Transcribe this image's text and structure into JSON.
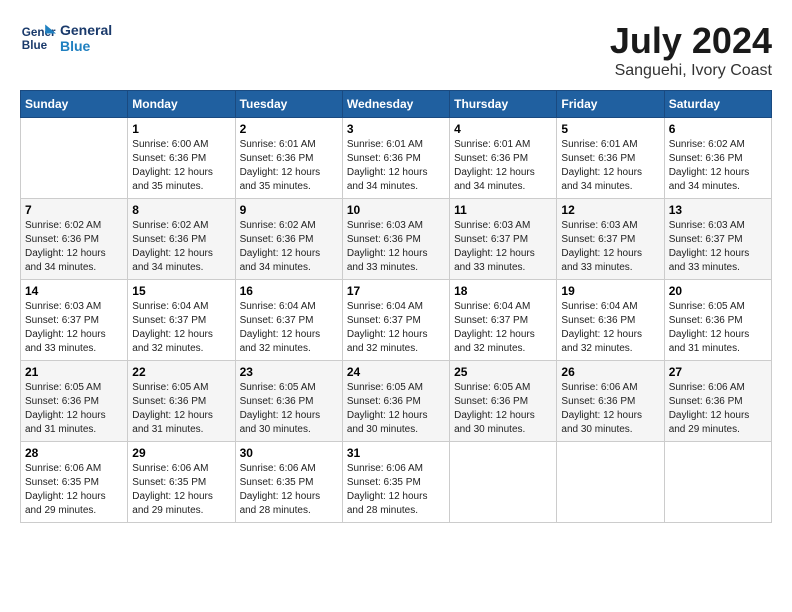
{
  "logo": {
    "line1": "General",
    "line2": "Blue"
  },
  "title": "July 2024",
  "subtitle": "Sanguehi, Ivory Coast",
  "days_of_week": [
    "Sunday",
    "Monday",
    "Tuesday",
    "Wednesday",
    "Thursday",
    "Friday",
    "Saturday"
  ],
  "weeks": [
    [
      {
        "day": "",
        "info": ""
      },
      {
        "day": "1",
        "info": "Sunrise: 6:00 AM\nSunset: 6:36 PM\nDaylight: 12 hours\nand 35 minutes."
      },
      {
        "day": "2",
        "info": "Sunrise: 6:01 AM\nSunset: 6:36 PM\nDaylight: 12 hours\nand 35 minutes."
      },
      {
        "day": "3",
        "info": "Sunrise: 6:01 AM\nSunset: 6:36 PM\nDaylight: 12 hours\nand 34 minutes."
      },
      {
        "day": "4",
        "info": "Sunrise: 6:01 AM\nSunset: 6:36 PM\nDaylight: 12 hours\nand 34 minutes."
      },
      {
        "day": "5",
        "info": "Sunrise: 6:01 AM\nSunset: 6:36 PM\nDaylight: 12 hours\nand 34 minutes."
      },
      {
        "day": "6",
        "info": "Sunrise: 6:02 AM\nSunset: 6:36 PM\nDaylight: 12 hours\nand 34 minutes."
      }
    ],
    [
      {
        "day": "7",
        "info": "Sunrise: 6:02 AM\nSunset: 6:36 PM\nDaylight: 12 hours\nand 34 minutes."
      },
      {
        "day": "8",
        "info": "Sunrise: 6:02 AM\nSunset: 6:36 PM\nDaylight: 12 hours\nand 34 minutes."
      },
      {
        "day": "9",
        "info": "Sunrise: 6:02 AM\nSunset: 6:36 PM\nDaylight: 12 hours\nand 34 minutes."
      },
      {
        "day": "10",
        "info": "Sunrise: 6:03 AM\nSunset: 6:36 PM\nDaylight: 12 hours\nand 33 minutes."
      },
      {
        "day": "11",
        "info": "Sunrise: 6:03 AM\nSunset: 6:37 PM\nDaylight: 12 hours\nand 33 minutes."
      },
      {
        "day": "12",
        "info": "Sunrise: 6:03 AM\nSunset: 6:37 PM\nDaylight: 12 hours\nand 33 minutes."
      },
      {
        "day": "13",
        "info": "Sunrise: 6:03 AM\nSunset: 6:37 PM\nDaylight: 12 hours\nand 33 minutes."
      }
    ],
    [
      {
        "day": "14",
        "info": "Sunrise: 6:03 AM\nSunset: 6:37 PM\nDaylight: 12 hours\nand 33 minutes."
      },
      {
        "day": "15",
        "info": "Sunrise: 6:04 AM\nSunset: 6:37 PM\nDaylight: 12 hours\nand 32 minutes."
      },
      {
        "day": "16",
        "info": "Sunrise: 6:04 AM\nSunset: 6:37 PM\nDaylight: 12 hours\nand 32 minutes."
      },
      {
        "day": "17",
        "info": "Sunrise: 6:04 AM\nSunset: 6:37 PM\nDaylight: 12 hours\nand 32 minutes."
      },
      {
        "day": "18",
        "info": "Sunrise: 6:04 AM\nSunset: 6:37 PM\nDaylight: 12 hours\nand 32 minutes."
      },
      {
        "day": "19",
        "info": "Sunrise: 6:04 AM\nSunset: 6:36 PM\nDaylight: 12 hours\nand 32 minutes."
      },
      {
        "day": "20",
        "info": "Sunrise: 6:05 AM\nSunset: 6:36 PM\nDaylight: 12 hours\nand 31 minutes."
      }
    ],
    [
      {
        "day": "21",
        "info": "Sunrise: 6:05 AM\nSunset: 6:36 PM\nDaylight: 12 hours\nand 31 minutes."
      },
      {
        "day": "22",
        "info": "Sunrise: 6:05 AM\nSunset: 6:36 PM\nDaylight: 12 hours\nand 31 minutes."
      },
      {
        "day": "23",
        "info": "Sunrise: 6:05 AM\nSunset: 6:36 PM\nDaylight: 12 hours\nand 30 minutes."
      },
      {
        "day": "24",
        "info": "Sunrise: 6:05 AM\nSunset: 6:36 PM\nDaylight: 12 hours\nand 30 minutes."
      },
      {
        "day": "25",
        "info": "Sunrise: 6:05 AM\nSunset: 6:36 PM\nDaylight: 12 hours\nand 30 minutes."
      },
      {
        "day": "26",
        "info": "Sunrise: 6:06 AM\nSunset: 6:36 PM\nDaylight: 12 hours\nand 30 minutes."
      },
      {
        "day": "27",
        "info": "Sunrise: 6:06 AM\nSunset: 6:36 PM\nDaylight: 12 hours\nand 29 minutes."
      }
    ],
    [
      {
        "day": "28",
        "info": "Sunrise: 6:06 AM\nSunset: 6:35 PM\nDaylight: 12 hours\nand 29 minutes."
      },
      {
        "day": "29",
        "info": "Sunrise: 6:06 AM\nSunset: 6:35 PM\nDaylight: 12 hours\nand 29 minutes."
      },
      {
        "day": "30",
        "info": "Sunrise: 6:06 AM\nSunset: 6:35 PM\nDaylight: 12 hours\nand 28 minutes."
      },
      {
        "day": "31",
        "info": "Sunrise: 6:06 AM\nSunset: 6:35 PM\nDaylight: 12 hours\nand 28 minutes."
      },
      {
        "day": "",
        "info": ""
      },
      {
        "day": "",
        "info": ""
      },
      {
        "day": "",
        "info": ""
      }
    ]
  ]
}
